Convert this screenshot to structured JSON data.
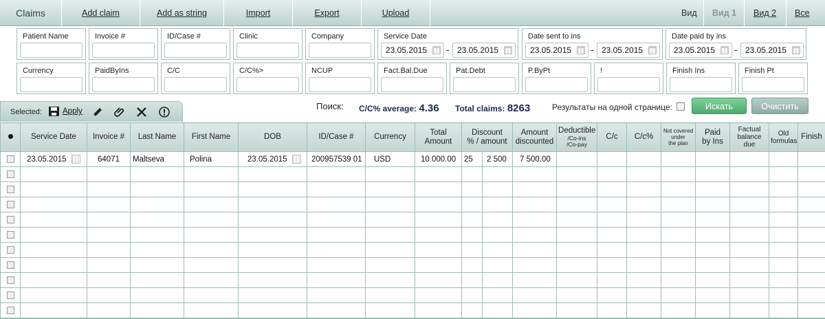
{
  "topbar": {
    "title": "Claims",
    "menu": [
      "Add claim",
      "Add as string",
      "Import",
      "Export",
      "Upload"
    ],
    "view_label": "Вид",
    "views": [
      "Вид 1",
      "Вид 2",
      "Все"
    ],
    "active_view": "Вид 1"
  },
  "filters": {
    "patient_name": "Patient Name",
    "invoice": "Invoice #",
    "id_case": "ID/Case #",
    "clinic": "Clinic",
    "company": "Company",
    "service_date": "Service Date",
    "date_sent": "Date sent to ins",
    "date_paid": "Date paid by ins",
    "currency": "Currency",
    "paid_by_ins": "PaidByIns",
    "cc": "C/C",
    "cc_pct": "C/C%>",
    "ncup": "NCUP",
    "fact_bal_due": "Fact.Bal.Due",
    "pat_debt": "Pat.Debt",
    "p_by_pt": "P.ByPt",
    "excl": "!",
    "finish_ins": "Finish Ins",
    "finish_pt": "Finish Pt",
    "service_from": "23.05.2015",
    "service_to": "23.05.2015",
    "sent_from": "23.05.2015",
    "sent_to": "23.05.2015",
    "paid_from": "23.05.2015",
    "paid_to": "23.05.2015"
  },
  "toolbar": {
    "selected_label": "Selected:",
    "apply_label": "Apply"
  },
  "search": {
    "label": "Поиск:",
    "cc_avg_label": "C/C% average:",
    "cc_avg_value": "4.36",
    "total_label": "Total claims:",
    "total_value": "8263",
    "per_page_label": "Результаты на одной странице:",
    "search_button": "Искать",
    "clear_button": "Очистить"
  },
  "table": {
    "headers": {
      "service_date": "Service Date",
      "invoice": "Invoice #",
      "last_name": "Last Name",
      "first_name": "First Name",
      "dob": "DOB",
      "id_case": "ID/Case #",
      "currency": "Currency",
      "total_amount_1": "Total",
      "total_amount_2": "Amount",
      "discount_1": "Discount",
      "discount_2": "% / amount",
      "amount_disc_1": "Amount",
      "amount_disc_2": "discounted",
      "deductible": "Deductible",
      "deductible_sub1": "/Co-ins",
      "deductible_sub2": "/Co-pay",
      "cc": "C/c",
      "cc_pct": "C/c%",
      "not_covered_1": "Not covered",
      "not_covered_2": "under",
      "not_covered_3": "the plan",
      "paid_ins_1": "Paid",
      "paid_ins_2": "by Ins",
      "factual_1": "Factual",
      "factual_2": "balance",
      "factual_3": "due",
      "old_1": "Old",
      "old_2": "formulas",
      "finish": "Finish"
    },
    "row": {
      "service_date": "23.05.2015",
      "invoice": "64071",
      "last_name": "Maltseva",
      "first_name": "Polina",
      "dob": "23.05.2015",
      "id_case": "200957539 01",
      "currency": "USD",
      "total_amount": "10 000.00",
      "discount_pct": "25",
      "discount_amount": "2 500",
      "amount_discounted": "7 500.00"
    }
  }
}
